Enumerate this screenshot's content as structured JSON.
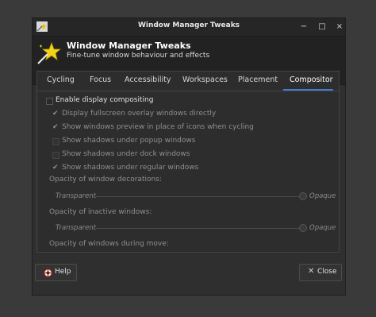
{
  "window": {
    "title": "Window Manager Tweaks",
    "controls": {
      "minimize": "−",
      "maximize": "□",
      "close": "×"
    }
  },
  "header": {
    "title": "Window Manager Tweaks",
    "subtitle": "Fine-tune window behaviour and effects"
  },
  "tabs": [
    {
      "label": "Cycling"
    },
    {
      "label": "Focus"
    },
    {
      "label": "Accessibility"
    },
    {
      "label": "Workspaces"
    },
    {
      "label": "Placement"
    },
    {
      "label": "Compositor"
    }
  ],
  "active_tab": "Compositor",
  "compositor": {
    "enable": {
      "label": "Enable display compositing",
      "checked": false
    },
    "options": [
      {
        "label": "Display fullscreen overlay windows directly",
        "checked": true
      },
      {
        "label": "Show windows preview in place of icons when cycling",
        "checked": true
      },
      {
        "label": "Show shadows under popup windows",
        "checked": false
      },
      {
        "label": "Show shadows under dock windows",
        "checked": false
      },
      {
        "label": "Show shadows under regular windows",
        "checked": true
      }
    ],
    "opacity_decorations": {
      "label": "Opacity of window decorations:",
      "min": "Transparent",
      "max": "Opaque",
      "value": 1.0
    },
    "opacity_inactive": {
      "label": "Opacity of inactive windows:",
      "min": "Transparent",
      "max": "Opaque",
      "value": 1.0
    },
    "opacity_move": {
      "label": "Opacity of windows during move:"
    }
  },
  "buttons": {
    "help": "Help",
    "close": "Close"
  },
  "colors": {
    "accent": "#3e7fcf",
    "background": "#2f2f2f",
    "header": "#222222"
  },
  "icons": {
    "app": "star-wand-icon",
    "help": "lifebuoy-icon",
    "close": "close-icon"
  }
}
